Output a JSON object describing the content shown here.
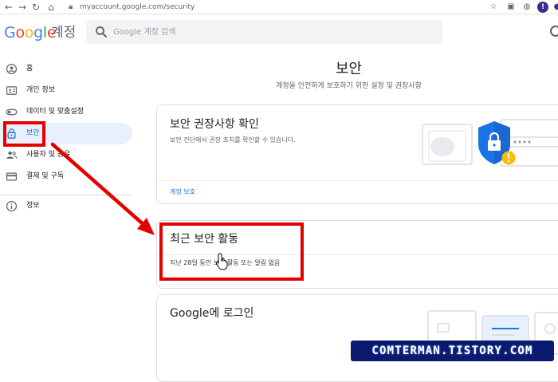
{
  "browser": {
    "back_icon": "arrow-left-icon",
    "forward_icon": "arrow-right-icon",
    "reload_icon": "reload-icon",
    "home_icon": "home-icon",
    "url": "myaccount.google.com/security"
  },
  "header": {
    "logo_word": [
      "G",
      "o",
      "o",
      "g",
      "l",
      "e"
    ],
    "logo_suffix": "계정",
    "search_placeholder": "Google 계정 검색"
  },
  "sidebar": {
    "items": [
      {
        "label": "홈",
        "icon": "person-circle-icon",
        "active": false
      },
      {
        "label": "개인 정보",
        "icon": "id-card-icon",
        "active": false
      },
      {
        "label": "데이터 및 맞춤설정",
        "icon": "toggle-icon",
        "active": false
      },
      {
        "label": "보안",
        "icon": "lock-icon",
        "active": true
      },
      {
        "label": "사용자 및 공유",
        "icon": "people-icon",
        "active": false
      },
      {
        "label": "결제 및 구독",
        "icon": "credit-card-icon",
        "active": false
      },
      {
        "label": "정보",
        "icon": "info-icon",
        "active": false
      }
    ]
  },
  "main": {
    "title": "보안",
    "subtitle": "계정을 안전하게 보호하기 위한 설정 및 권장사항",
    "cards": [
      {
        "title": "보안 권장사항 확인",
        "desc": "보안 진단에서 권장 조치를 확인할 수 있습니다.",
        "link": "계정 보호"
      },
      {
        "title": "최근 보안 활동",
        "desc": "지난 28일 동안 보안 활동 또는 알림 없음"
      },
      {
        "title": "Google에 로그인"
      }
    ]
  },
  "annotation": {
    "watermark": "COMTERMAN.TISTORY.COM",
    "highlight_color": "#e50000"
  },
  "colors": {
    "accent": "#1a73e8",
    "active_bg": "#e8f0fe",
    "shield_blue": "#1a73e8",
    "warning_yellow": "#fbbc04"
  }
}
